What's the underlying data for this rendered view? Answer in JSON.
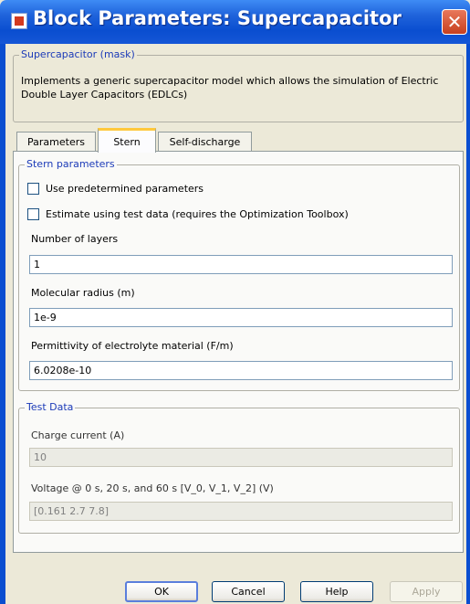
{
  "window": {
    "title": "Block Parameters: Supercapacitor",
    "close_symbol": "✕"
  },
  "mask": {
    "group_label": "Supercapacitor (mask)",
    "description": "Implements a generic supercapacitor model which allows the simulation of Electric Double Layer Capacitors (EDLCs)"
  },
  "tabs": [
    {
      "label": "Parameters",
      "active": false
    },
    {
      "label": "Stern",
      "active": true
    },
    {
      "label": "Self-discharge",
      "active": false
    }
  ],
  "stern": {
    "group_label": "Stern parameters",
    "use_predetermined": {
      "label": "Use predetermined parameters",
      "checked": false
    },
    "estimate_test_data": {
      "label": "Estimate using test data (requires the Optimization Toolbox)",
      "checked": false
    },
    "num_layers": {
      "label": "Number of layers",
      "value": "1"
    },
    "molecular_radius": {
      "label": "Molecular radius (m)",
      "value": "1e-9"
    },
    "permittivity": {
      "label": "Permittivity of electrolyte material (F/m)",
      "value": "6.0208e-10"
    }
  },
  "test_data": {
    "group_label": "Test Data",
    "charge_current": {
      "label": "Charge current (A)",
      "value": "10"
    },
    "voltage": {
      "label": "Voltage @ 0 s, 20 s, and 60 s [V_0, V_1, V_2] (V)",
      "value": "[0.161 2.7 7.8]"
    }
  },
  "buttons": {
    "ok": "OK",
    "cancel": "Cancel",
    "help": "Help",
    "apply": "Apply"
  },
  "colors": {
    "titlebar": "#0A4ED0",
    "dialog_bg": "#ECE9D8",
    "group_label": "#1C3BB8",
    "active_tab_accent": "#FFC83C"
  }
}
